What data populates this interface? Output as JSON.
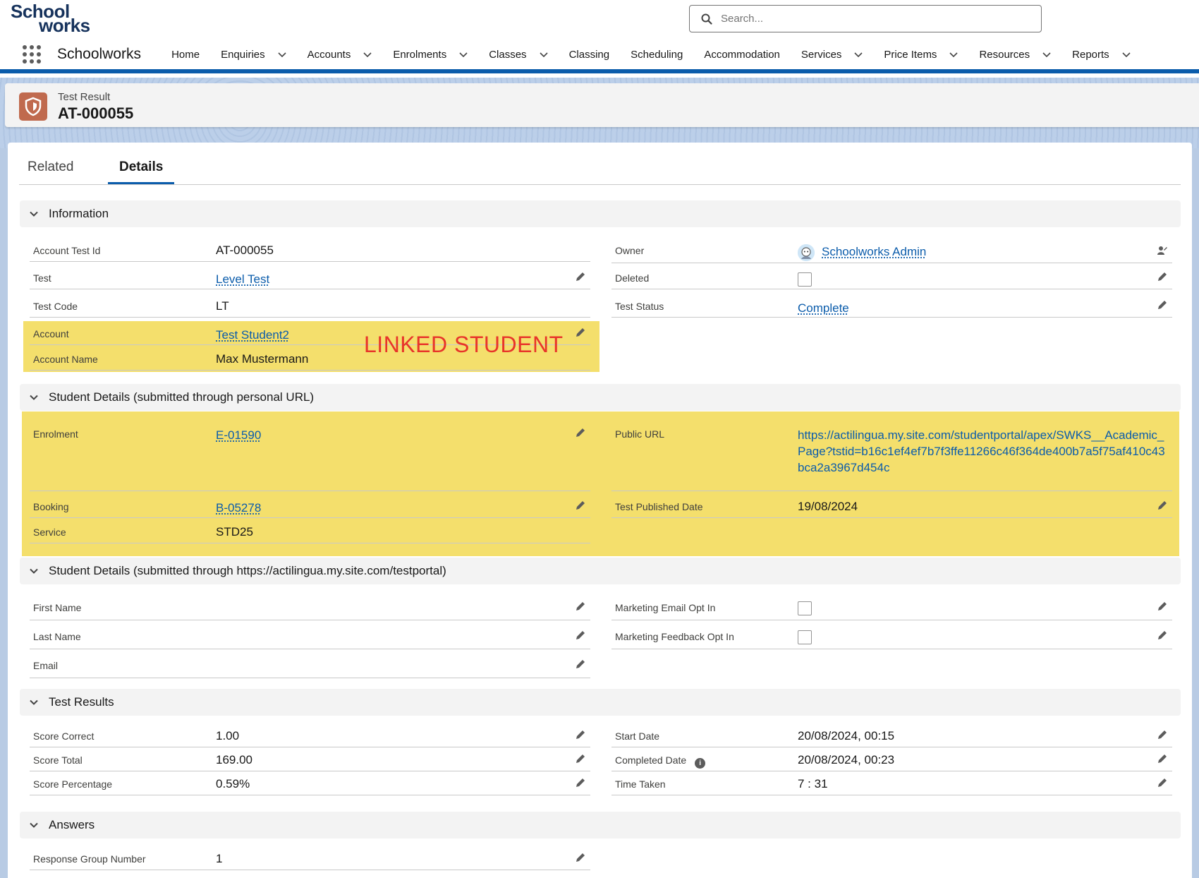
{
  "header": {
    "logo_line1": "School",
    "logo_line2": "works",
    "search_placeholder": "Search..."
  },
  "nav": {
    "app_name": "Schoolworks",
    "items": [
      {
        "label": "Home",
        "has_menu": false
      },
      {
        "label": "Enquiries",
        "has_menu": true
      },
      {
        "label": "Accounts",
        "has_menu": true
      },
      {
        "label": "Enrolments",
        "has_menu": true
      },
      {
        "label": "Classes",
        "has_menu": true
      },
      {
        "label": "Classing",
        "has_menu": false
      },
      {
        "label": "Scheduling",
        "has_menu": false
      },
      {
        "label": "Accommodation",
        "has_menu": false
      },
      {
        "label": "Services",
        "has_menu": true
      },
      {
        "label": "Price Items",
        "has_menu": true
      },
      {
        "label": "Resources",
        "has_menu": true
      },
      {
        "label": "Reports",
        "has_menu": true
      }
    ]
  },
  "record": {
    "type": "Test Result",
    "title": "AT-000055",
    "icon": "shield-icon"
  },
  "tabs": [
    {
      "label": "Related",
      "active": false
    },
    {
      "label": "Details",
      "active": true
    }
  ],
  "annotation": "LINKED STUDENT",
  "sections": {
    "information": {
      "title": "Information",
      "account_test_id": {
        "label": "Account Test Id",
        "value": "AT-000055"
      },
      "test": {
        "label": "Test",
        "value": "Level Test"
      },
      "test_code": {
        "label": "Test Code",
        "value": "LT"
      },
      "account": {
        "label": "Account",
        "value": "Test Student2"
      },
      "account_name": {
        "label": "Account Name",
        "value": "Max Mustermann"
      },
      "owner": {
        "label": "Owner",
        "value": "Schoolworks Admin"
      },
      "deleted": {
        "label": "Deleted",
        "checked": false
      },
      "test_status": {
        "label": "Test Status",
        "value": "Complete"
      }
    },
    "student_personal": {
      "title": "Student Details (submitted through personal URL)",
      "enrolment": {
        "label": "Enrolment",
        "value": "E-01590"
      },
      "booking": {
        "label": "Booking",
        "value": "B-05278"
      },
      "service": {
        "label": "Service",
        "value": "STD25"
      },
      "public_url": {
        "label": "Public URL",
        "value": "https://actilingua.my.site.com/studentportal/apex/SWKS__Academic_Page?tstid=b16c1ef4ef7b7f3ffe11266c46f364de400b7a5f75af410c43bca2a3967d454c"
      },
      "test_published_date": {
        "label": "Test Published Date",
        "value": "19/08/2024"
      }
    },
    "student_portal": {
      "title": "Student Details (submitted through https://actilingua.my.site.com/testportal)",
      "first_name": {
        "label": "First Name",
        "value": ""
      },
      "last_name": {
        "label": "Last Name",
        "value": ""
      },
      "email": {
        "label": "Email",
        "value": ""
      },
      "marketing_email": {
        "label": "Marketing Email Opt In",
        "checked": false
      },
      "marketing_feedback": {
        "label": "Marketing Feedback Opt In",
        "checked": false
      }
    },
    "test_results": {
      "title": "Test Results",
      "score_correct": {
        "label": "Score Correct",
        "value": "1.00"
      },
      "score_total": {
        "label": "Score Total",
        "value": "169.00"
      },
      "score_percentage": {
        "label": "Score Percentage",
        "value": "0.59%"
      },
      "start_date": {
        "label": "Start Date",
        "value": "20/08/2024, 00:15"
      },
      "completed_date": {
        "label": "Completed Date",
        "value": "20/08/2024, 00:23"
      },
      "time_taken": {
        "label": "Time Taken",
        "value": "7 : 31"
      }
    },
    "answers": {
      "title": "Answers",
      "response_group_number": {
        "label": "Response Group Number",
        "value": "1"
      }
    }
  },
  "colors": {
    "brand": "#0b5cab",
    "highlight": "#f4df6c",
    "annotation": "#e8342a",
    "record_icon": "#c06a4e"
  }
}
